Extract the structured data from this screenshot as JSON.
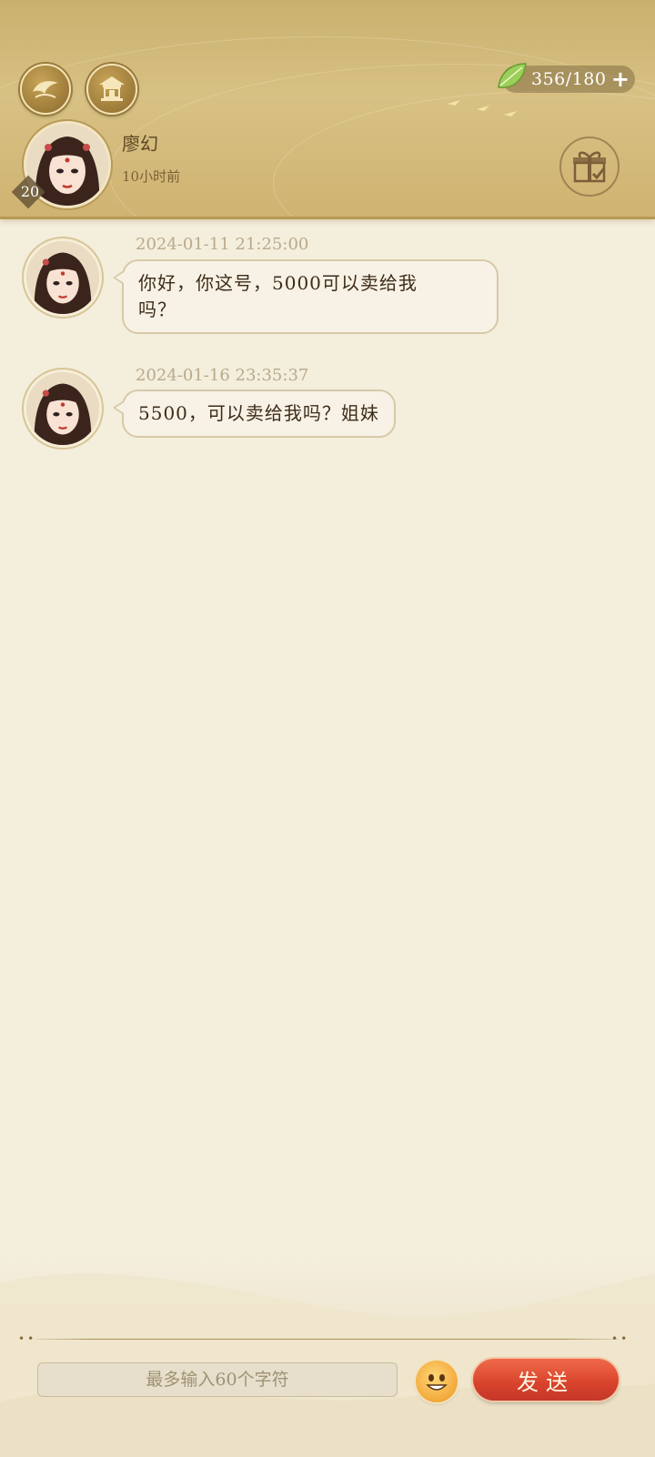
{
  "header": {
    "stamina": "356/180",
    "stamina_plus": "+",
    "level": "20",
    "name": "廖幻",
    "last_seen": "10小时前"
  },
  "messages": [
    {
      "time": "2024-01-11 21:25:00",
      "line1": "你好，你这号，5000可以卖给我",
      "line2": "吗？"
    },
    {
      "time": "2024-01-16 23:35:37",
      "line1": "5500，可以卖给我吗？姐妹"
    }
  ],
  "input": {
    "placeholder": "最多输入60个字符"
  },
  "send_label": "发送",
  "decor": {
    "dots": "••"
  },
  "icons": [
    "story-icon",
    "pavilion-icon",
    "leaf-icon",
    "gift-icon",
    "emoji-icon"
  ],
  "colors": {
    "header_gold": "#d8c184",
    "send_red": "#d8432b",
    "bubble_bg": "#f8f2e6"
  }
}
